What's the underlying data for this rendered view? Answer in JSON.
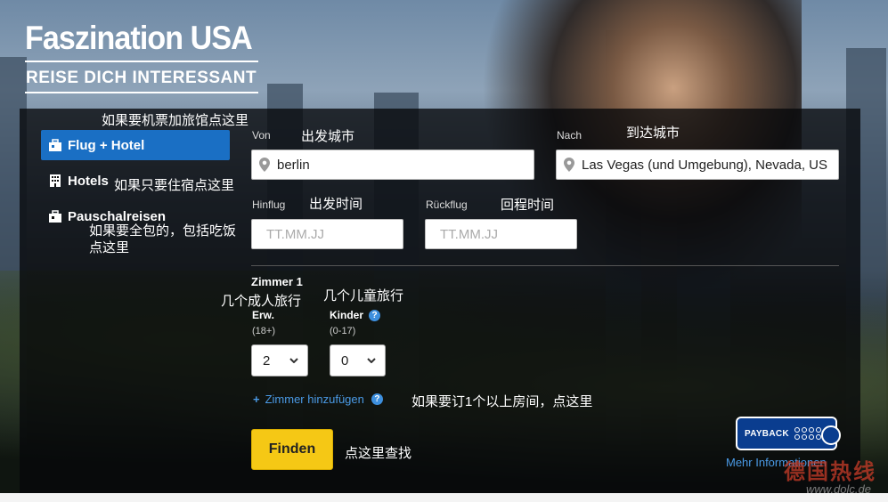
{
  "brand": {
    "title": "Faszination USA",
    "subtitle": "REISE DICH INTERESSANT"
  },
  "nav": {
    "items": [
      {
        "label": "Flug + Hotel",
        "icon": "suitcase-icon",
        "active": true
      },
      {
        "label": "Hotels",
        "icon": "building-icon",
        "active": false
      },
      {
        "label": "Pauschalreisen",
        "icon": "suitcase-icon",
        "active": false
      }
    ]
  },
  "annotations": {
    "flug_hotel": "如果要机票加旅馆点这里",
    "hotels": "如果只要住宿点这里",
    "pauschal_line1": "如果要全包的，包括吃饭",
    "pauschal_line2": "点这里",
    "from": "出发城市",
    "to": "到达城市",
    "depart": "出发时间",
    "return": "回程时间",
    "adults": "几个成人旅行",
    "children": "几个儿童旅行",
    "add_room": "如果要订1个以上房间，点这里",
    "find": "点这里查找"
  },
  "form": {
    "from_label": "Von",
    "from_value": "berlin",
    "to_label": "Nach",
    "to_value": "Las Vegas (und Umgebung), Nevada, US",
    "depart_label": "Hinflug",
    "depart_placeholder": "TT.MM.JJ",
    "return_label": "Rückflug",
    "return_placeholder": "TT.MM.JJ",
    "room_title": "Zimmer 1",
    "adults_label": "Erw.",
    "adults_range": "(18+)",
    "adults_value": "2",
    "children_label": "Kinder",
    "children_range": "(0-17)",
    "children_value": "0",
    "add_room_label": "Zimmer hinzufügen",
    "find_label": "Finden",
    "help_glyph": "?"
  },
  "payback": {
    "label": "PAYBACK",
    "more_info": "Mehr Informationen"
  },
  "watermark": {
    "text": "德国热线",
    "url": "www.dolc.de"
  }
}
